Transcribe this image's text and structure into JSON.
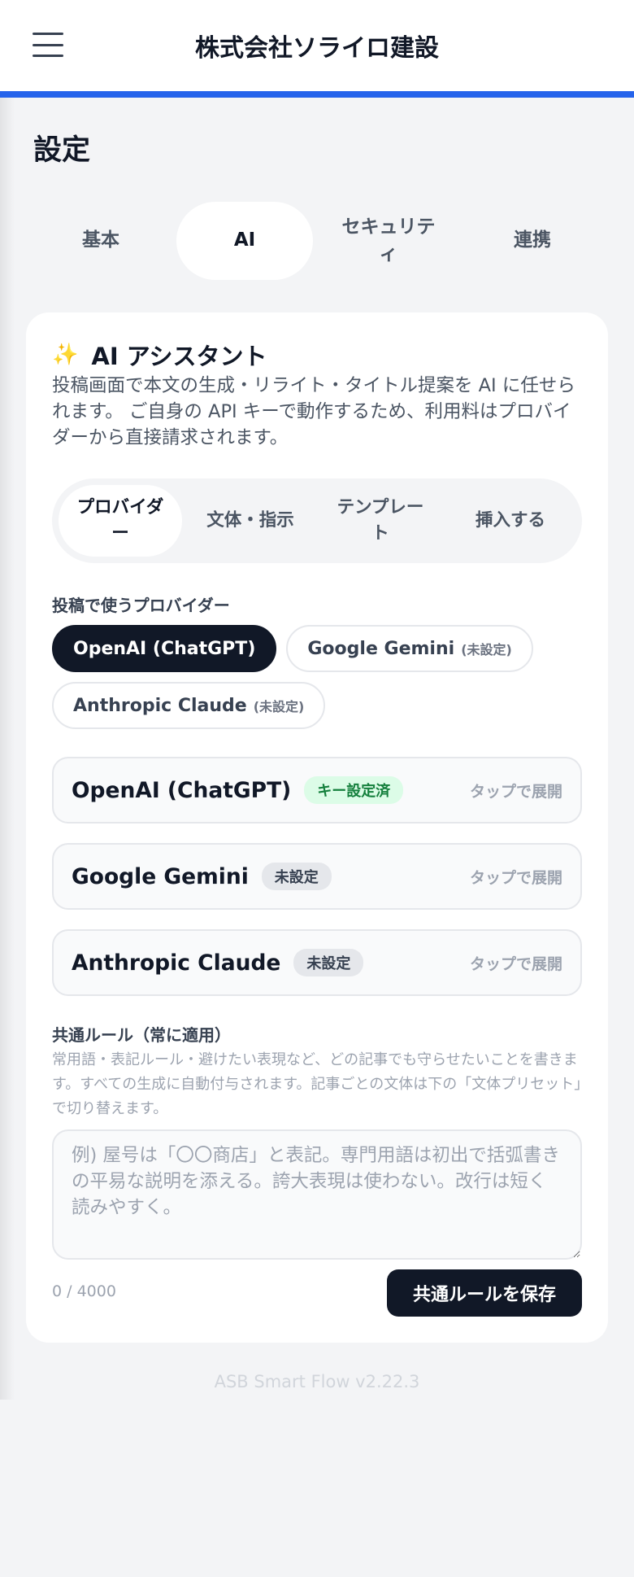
{
  "header": {
    "title": "株式会社ソライロ建設"
  },
  "page": {
    "title": "設定"
  },
  "main_tabs": [
    {
      "label": "基本",
      "active": false
    },
    {
      "label": "AI",
      "active": true
    },
    {
      "label": "セキュリティ",
      "active": false
    },
    {
      "label": "連携",
      "active": false
    }
  ],
  "card": {
    "icon": "sparkle-icon",
    "title": "AI アシスタント",
    "description": "投稿画面で本文の生成・リライト・タイトル提案を AI に任せられます。 ご自身の API キーで動作するため、利用料はプロバイダーから直接請求されます。"
  },
  "sub_tabs": [
    {
      "label": "プロバイダー",
      "active": true
    },
    {
      "label": "文体・指示",
      "active": false
    },
    {
      "label": "テンプレート",
      "active": false
    },
    {
      "label": "挿入する",
      "active": false
    }
  ],
  "provider_select": {
    "label": "投稿で使うプロバイダー",
    "options": [
      {
        "label": "OpenAI (ChatGPT)",
        "note": "",
        "selected": true
      },
      {
        "label": "Google Gemini",
        "note": "(未設定)",
        "selected": false
      },
      {
        "label": "Anthropic Claude",
        "note": "(未設定)",
        "selected": false
      }
    ]
  },
  "providers": [
    {
      "name": "OpenAI (ChatGPT)",
      "status": "キー設定済",
      "configured": true,
      "hint": "タップで展開"
    },
    {
      "name": "Google Gemini",
      "status": "未設定",
      "configured": false,
      "hint": "タップで展開"
    },
    {
      "name": "Anthropic Claude",
      "status": "未設定",
      "configured": false,
      "hint": "タップで展開"
    }
  ],
  "common_rule": {
    "label": "共通ルール（常に適用）",
    "help": "常用語・表記ルール・避けたい表現など、どの記事でも守らせたいことを書きます。すべての生成に自動付与されます。記事ごとの文体は下の「文体プリセット」で切り替えます。",
    "value": "",
    "placeholder": "例) 屋号は「〇〇商店」と表記。専門用語は初出で括弧書きの平易な説明を添える。誇大表現は使わない。改行は短く読みやすく。",
    "count": "0 / 4000",
    "save_label": "共通ルールを保存"
  },
  "footer": {
    "version": "ASB Smart Flow v2.22.3"
  },
  "colors": {
    "accent": "#2563eb",
    "dark": "#111827",
    "ok_bg": "#dcfce7",
    "ok_text": "#15803d"
  }
}
